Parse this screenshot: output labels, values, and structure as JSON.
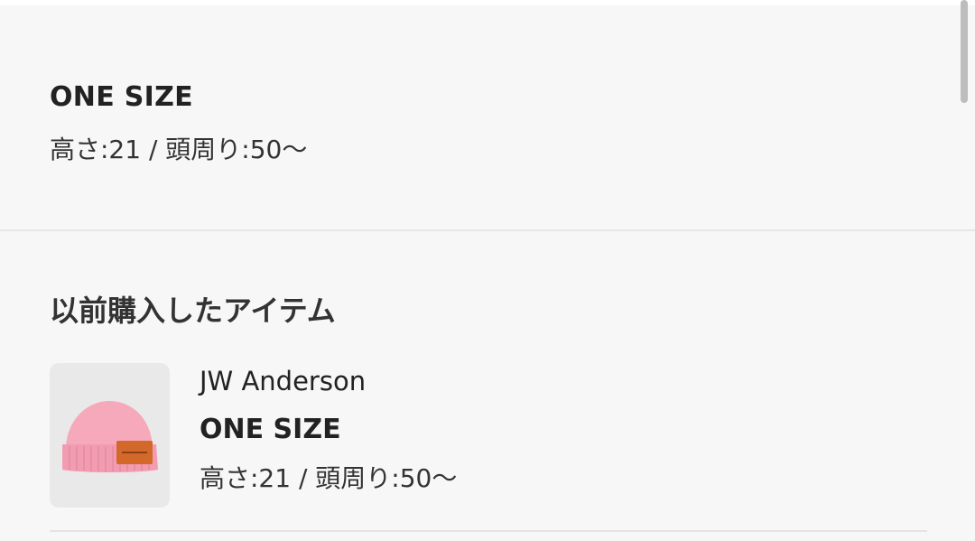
{
  "size_section": {
    "title": "ONE SIZE",
    "detail": "高さ:21 / 頭周り:50〜"
  },
  "previous_purchases": {
    "heading": "以前購入したアイテム",
    "items": [
      {
        "image_icon": "pink-beanie-image",
        "brand": "JW Anderson",
        "size": "ONE SIZE",
        "detail": "高さ:21 / 頭周り:50〜"
      }
    ]
  },
  "colors": {
    "background": "#f7f7f7",
    "thumb_bg": "#e9e9e9",
    "beanie_pink": "#f4a3b6",
    "label_orange": "#d2692a"
  }
}
